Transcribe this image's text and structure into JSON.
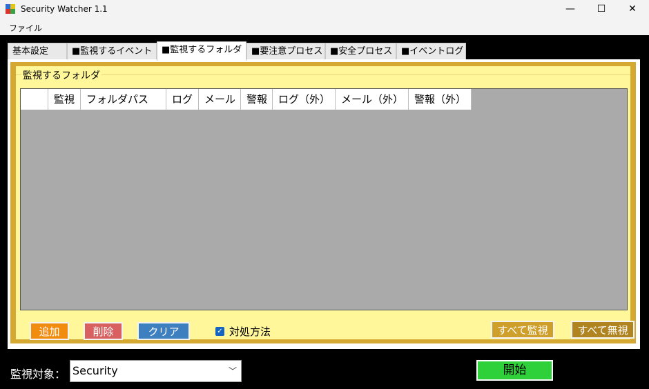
{
  "window": {
    "title": "Security Watcher 1.1"
  },
  "menu": {
    "items": [
      "ファイル"
    ]
  },
  "tabs": [
    {
      "label": "基本設定"
    },
    {
      "label": "■監視するイベント"
    },
    {
      "label": "■監視するフォルダ"
    },
    {
      "label": "■要注意プロセス"
    },
    {
      "label": "■安全プロセス"
    },
    {
      "label": "■イベントログ"
    }
  ],
  "group": {
    "title": "監視するフォルダ"
  },
  "grid": {
    "columns": [
      "",
      "監視",
      "フォルダパス",
      "ログ",
      "メール",
      "警報",
      "ログ（外）",
      "メール（外）",
      "警報（外）"
    ]
  },
  "buttons": {
    "add": "追加",
    "delete": "削除",
    "clear": "クリア",
    "all_watch": "すべて監視",
    "all_ignore": "すべて無視",
    "start": "開始"
  },
  "options": {
    "action_label": "対処方法",
    "action_checked": true
  },
  "target": {
    "label": "監視対象：",
    "value": "Security"
  },
  "colors": {
    "group_border": "#d5a832",
    "group_bg": "#fff799",
    "start": "#2fd13a"
  }
}
